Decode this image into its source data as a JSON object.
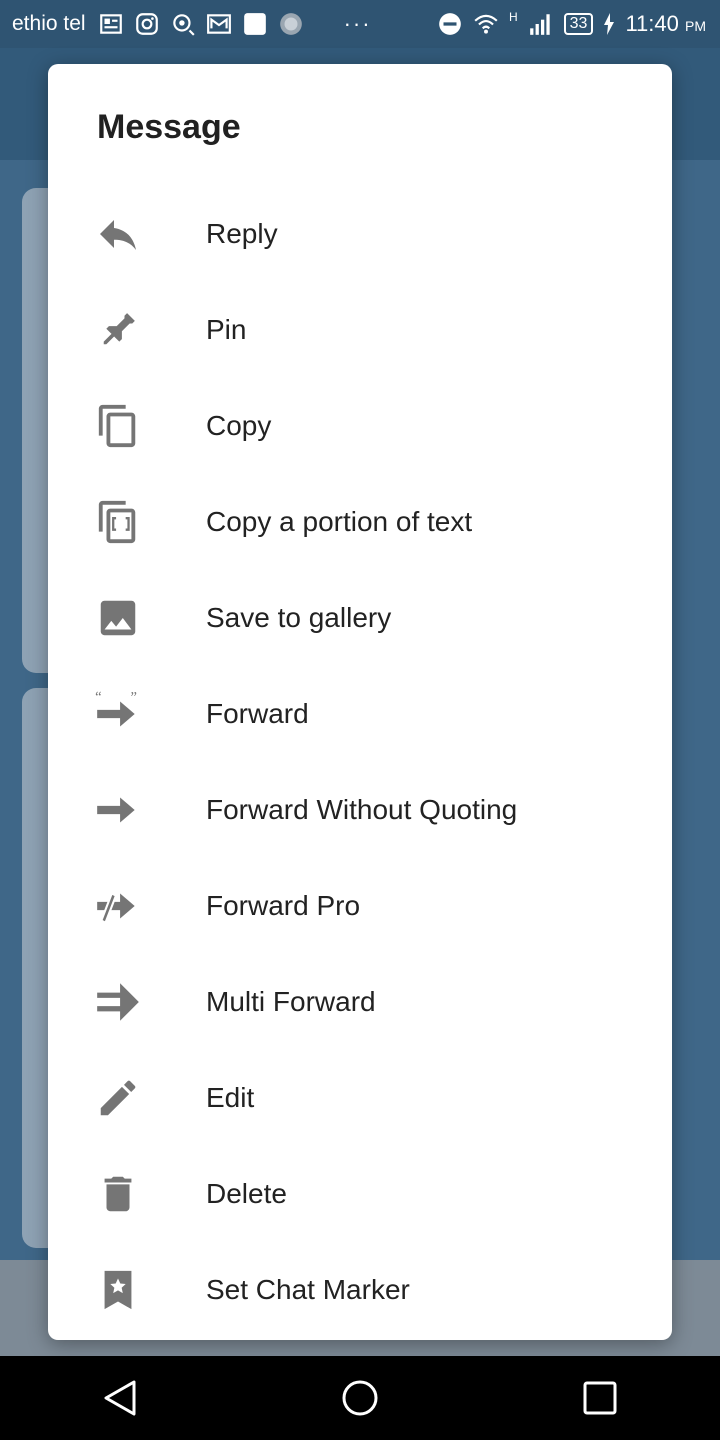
{
  "status_bar": {
    "carrier": "ethio tel",
    "overflow": "···",
    "battery": "33",
    "time": "11:40",
    "ampm": "PM",
    "network_label": "H"
  },
  "dialog": {
    "title": "Message",
    "items": [
      {
        "label": "Reply",
        "icon": "reply-icon"
      },
      {
        "label": "Pin",
        "icon": "pin-icon"
      },
      {
        "label": "Copy",
        "icon": "copy-icon"
      },
      {
        "label": "Copy a portion of text",
        "icon": "copy-portion-icon"
      },
      {
        "label": "Save to gallery",
        "icon": "image-icon"
      },
      {
        "label": "Forward",
        "icon": "forward-quote-icon"
      },
      {
        "label": "Forward Without Quoting",
        "icon": "forward-arrow-icon"
      },
      {
        "label": "Forward Pro",
        "icon": "forward-pro-icon"
      },
      {
        "label": "Multi Forward",
        "icon": "multi-forward-icon"
      },
      {
        "label": "Edit",
        "icon": "pencil-icon"
      },
      {
        "label": "Delete",
        "icon": "trash-icon"
      },
      {
        "label": "Set Chat Marker",
        "icon": "bookmark-star-icon"
      }
    ]
  },
  "colors": {
    "icon": "#757575",
    "text": "#222222",
    "status_bar": "#2f5472"
  }
}
